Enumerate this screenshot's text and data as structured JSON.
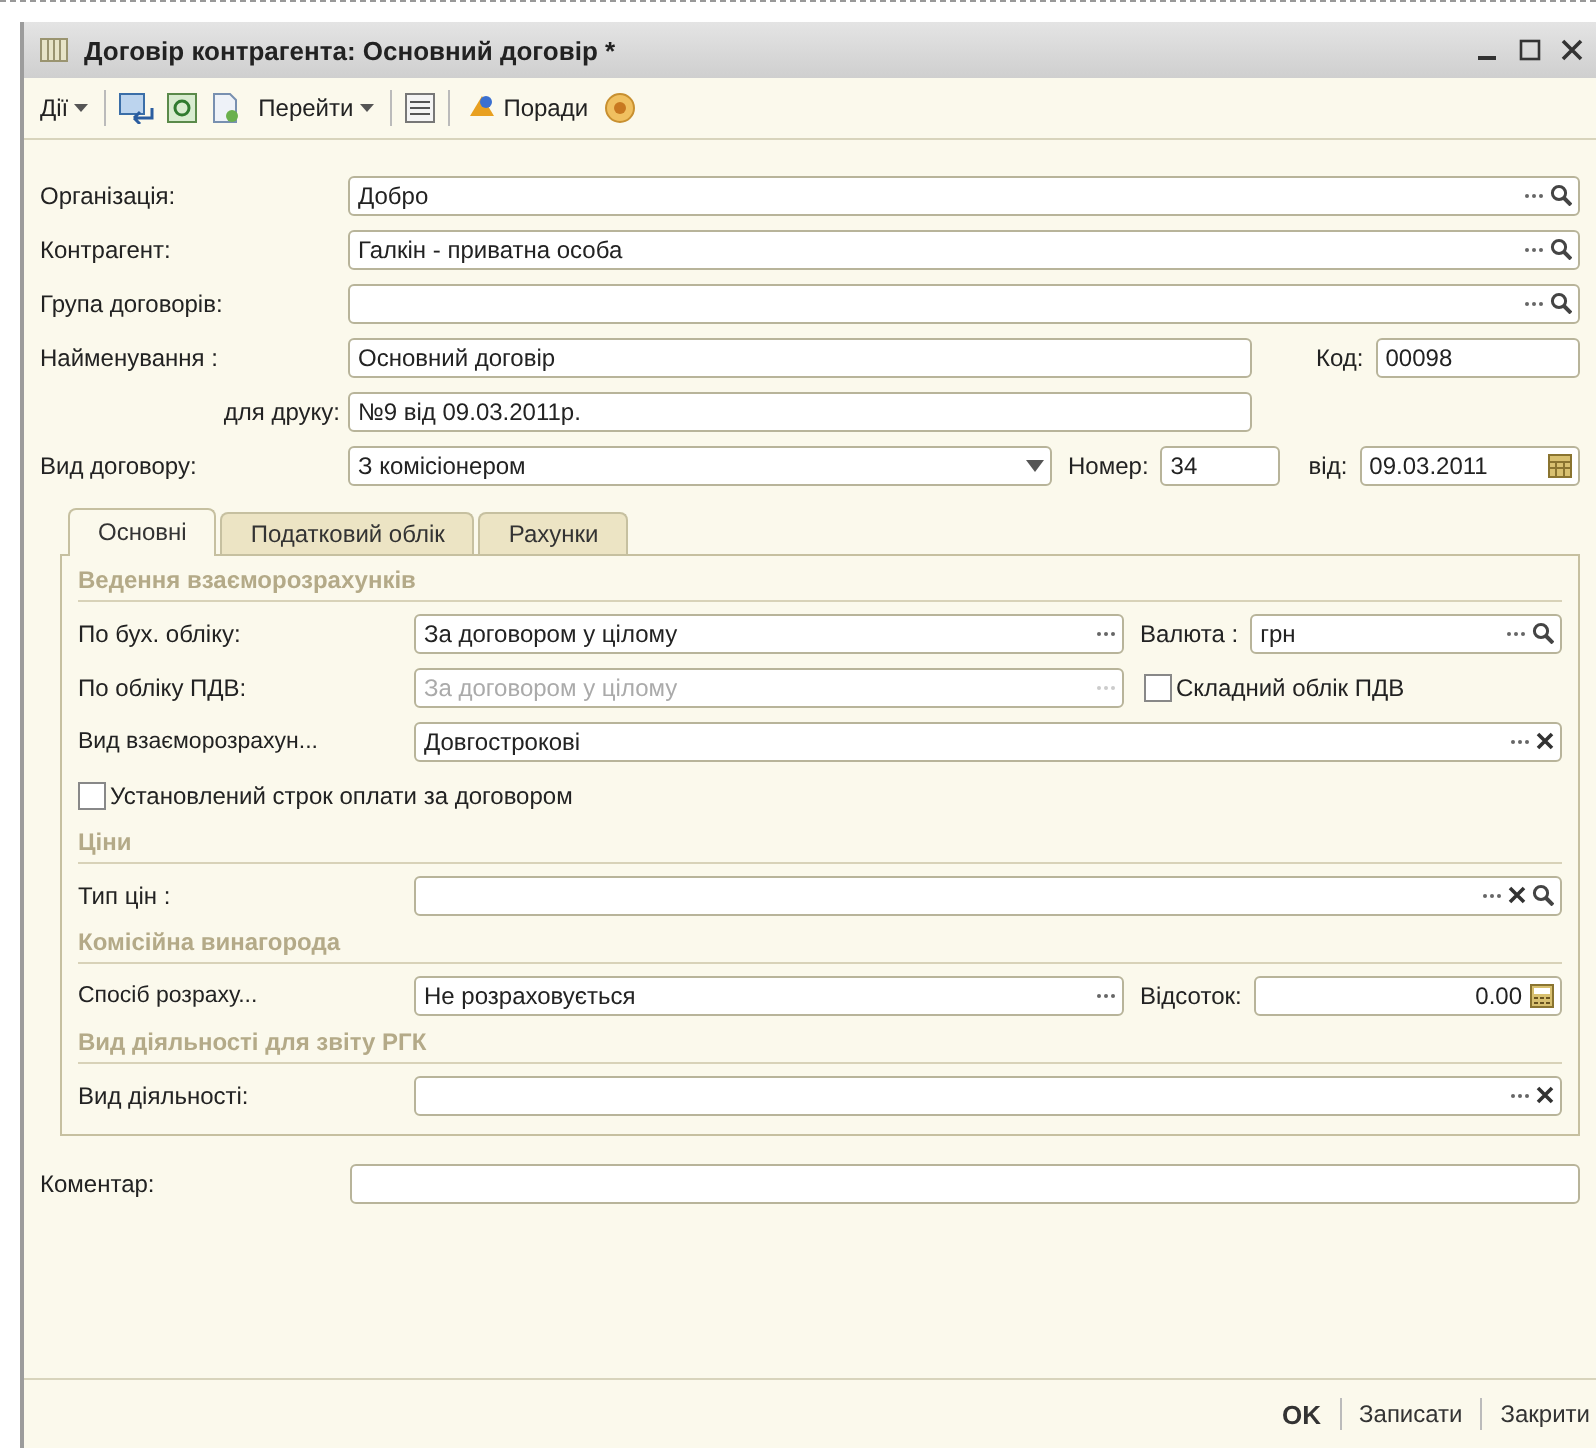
{
  "window": {
    "title": "Договір контрагента: Основний договір *"
  },
  "toolbar": {
    "actions_menu": "Дії",
    "goto_menu": "Перейти",
    "tips": "Поради"
  },
  "organization": {
    "label": "Організація:",
    "value": "Добро"
  },
  "counterparty": {
    "label": "Контрагент:",
    "value": "Галкін - приватна особа"
  },
  "contract_group": {
    "label": "Група договорів:"
  },
  "name": {
    "label": "Найменування :",
    "value": "Основний договір"
  },
  "code": {
    "label": "Код:",
    "value": "00098"
  },
  "print_name": {
    "label": "для друку:",
    "value": "№9 від 09.03.2011р."
  },
  "contract_type": {
    "label": "Вид договору:",
    "value": "З комісіонером"
  },
  "number": {
    "label": "Номер:",
    "value": "34"
  },
  "date": {
    "label": "від:",
    "value": "09.03.2011"
  },
  "tabs": [
    {
      "label": "Основні",
      "selected": true
    },
    {
      "label": "Податковий облік",
      "selected": false
    },
    {
      "label": "Рахунки",
      "selected": false
    }
  ],
  "settlements": {
    "header": "Ведення взаєморозрахунків",
    "bookkeeping": {
      "label": "По бух. обліку:",
      "value": "За договором у цілому",
      "disabled": false
    },
    "currency": {
      "label": "Валюта :",
      "value": "грн"
    },
    "vat": {
      "label": "По обліку ПДВ:",
      "value": "За договором у цілому",
      "disabled": true
    },
    "complex_vat": {
      "label": "Складний облік ПДВ",
      "checked": false
    },
    "settlement_type": {
      "label": "Вид взаєморозрахун...",
      "value": "Довгострокові"
    },
    "payment_term": {
      "label": "Установлений строк оплати за договором",
      "checked": false
    }
  },
  "prices": {
    "header": "Ціни",
    "price_type": {
      "label": "Тип цін :"
    }
  },
  "commission": {
    "header": "Комісійна винагорода",
    "method": {
      "label": "Спосіб розраху...",
      "value": "Не розраховується"
    },
    "percent": {
      "label": "Відсоток:",
      "value": "0.00"
    }
  },
  "activity": {
    "header": "Вид діяльності для звіту РГК",
    "activity_type": {
      "label": "Вид діяльності:"
    }
  },
  "comment": {
    "label": "Коментар:"
  },
  "buttons": [
    {
      "label": "OK",
      "default": true
    },
    {
      "label": "Записати",
      "default": false
    },
    {
      "label": "Закрити",
      "default": false
    }
  ]
}
